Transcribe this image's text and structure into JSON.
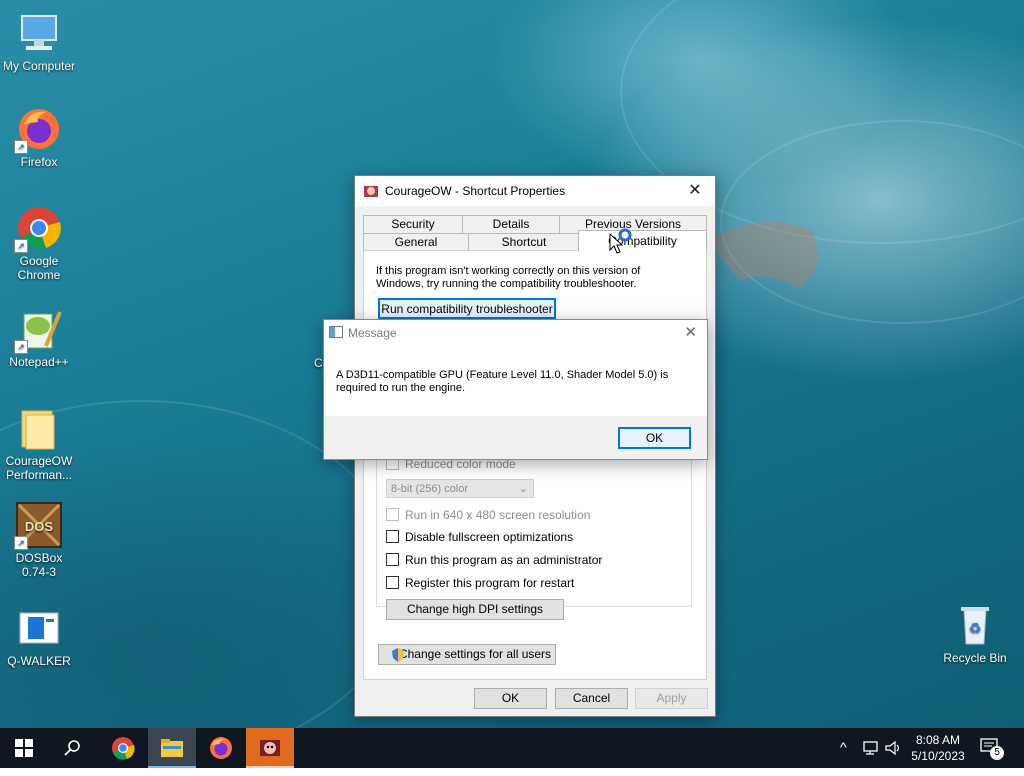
{
  "desktop": {
    "icons": [
      {
        "label": "My Computer",
        "icon": "computer-icon"
      },
      {
        "label": "Firefox",
        "icon": "firefox-icon"
      },
      {
        "label": "Google Chrome",
        "icon": "chrome-icon"
      },
      {
        "label": "Notepad++",
        "icon": "notepad-plus-plus-icon"
      },
      {
        "label": "CourageOW Performan...",
        "icon": "folder-icon"
      },
      {
        "label": "DOSBox 0.74-3",
        "icon": "dosbox-icon"
      },
      {
        "label": "Q-WALKER",
        "icon": "app-window-icon"
      },
      {
        "label": "Recycle Bin",
        "icon": "recycle-bin-icon"
      }
    ],
    "partial_label": "C"
  },
  "properties": {
    "title": "CourageOW - Shortcut Properties",
    "tabs_back": [
      "Security",
      "Details",
      "Previous Versions"
    ],
    "tabs_front": [
      "General",
      "Shortcut",
      "Compatibility"
    ],
    "intro": "If this program isn't working correctly on this version of Windows, try running the compatibility troubleshooter.",
    "troubleshoot_button": "Run compatibility troubleshooter",
    "options": {
      "reduced_color": "Reduced color mode",
      "color_select": "8-bit (256) color",
      "resolution": "Run in 640 x 480 screen resolution",
      "disable_fullscreen": "Disable fullscreen optimizations",
      "run_admin": "Run this program as an administrator",
      "register_restart": "Register this program for restart",
      "dpi_button": "Change high DPI settings"
    },
    "all_users_button": "Change settings for all users",
    "ok": "OK",
    "cancel": "Cancel",
    "apply": "Apply"
  },
  "message": {
    "title": "Message",
    "text": "A D3D11-compatible GPU (Feature Level 11.0, Shader Model 5.0) is required to run the engine.",
    "ok": "OK"
  },
  "taskbar": {
    "time": "8:08 AM",
    "date": "5/10/2023",
    "notifications": "5"
  },
  "colors": {
    "accent": "#0078d7",
    "taskbar": "#0f1820",
    "active_app": "#e06a1e"
  }
}
